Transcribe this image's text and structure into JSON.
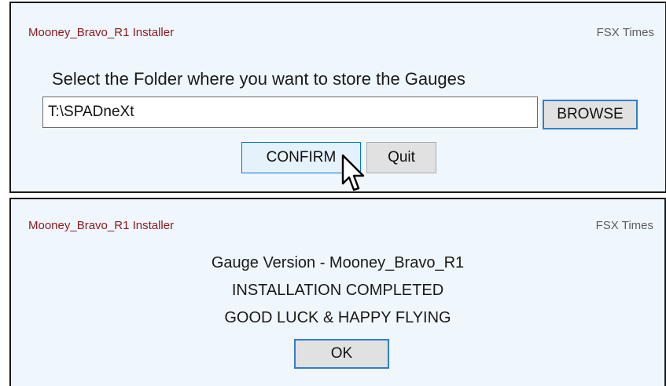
{
  "dialog_select": {
    "app_title": "Mooney_Bravo_R1 Installer",
    "brand": "FSX Times",
    "prompt": "Select the Folder where you want to store the Gauges",
    "folder_input_value": "T:\\SPADneXt",
    "browse_label": "BROWSE",
    "confirm_label": "CONFIRM",
    "quit_label": "Quit"
  },
  "dialog_done": {
    "app_title": "Mooney_Bravo_R1 Installer",
    "brand": "FSX Times",
    "message_lines": [
      "Gauge Version - Mooney_Bravo_R1",
      "INSTALLATION COMPLETED",
      "GOOD LUCK & HAPPY FLYING"
    ],
    "ok_label": "OK"
  },
  "colors": {
    "panel_background": "#eff6fc",
    "title_color": "#8b1a1a",
    "focus_border": "#2f7fd0"
  },
  "icons": {
    "cursor": "mouse-pointer-icon"
  }
}
